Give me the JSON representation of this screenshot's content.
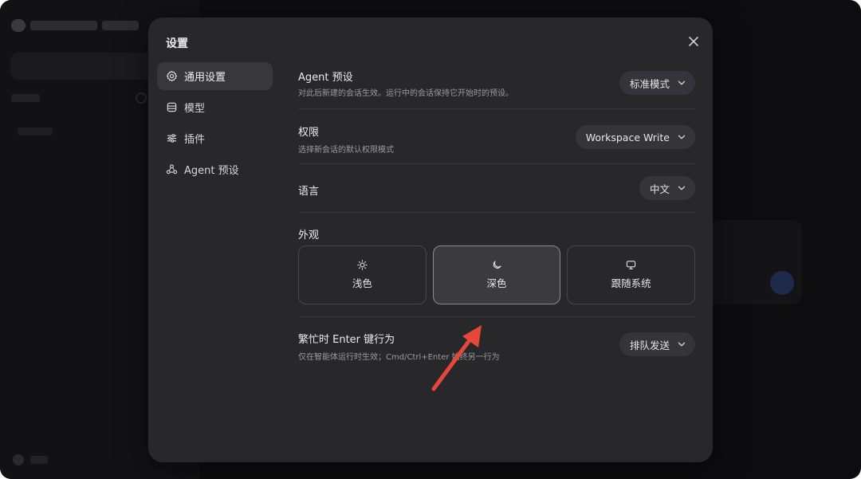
{
  "modal": {
    "title": "设置",
    "nav": [
      {
        "label": "通用设置",
        "icon": "gear-icon",
        "active": true
      },
      {
        "label": "模型",
        "icon": "database-icon"
      },
      {
        "label": "插件",
        "icon": "sliders-icon"
      },
      {
        "label": "Agent 预设",
        "icon": "agent-icon"
      }
    ]
  },
  "settings": {
    "agent_preset": {
      "title": "Agent 预设",
      "desc": "对此后新建的会话生效。运行中的会话保持它开始时的预设。",
      "value": "标准模式"
    },
    "permission": {
      "title": "权限",
      "desc": "选择新会话的默认权限模式",
      "value": "Workspace Write"
    },
    "language": {
      "title": "语言",
      "value": "中文"
    },
    "appearance": {
      "title": "外观",
      "options": [
        {
          "label": "浅色",
          "icon": "sun-icon"
        },
        {
          "label": "深色",
          "icon": "moon-icon",
          "selected": true
        },
        {
          "label": "跟随系统",
          "icon": "monitor-icon"
        }
      ]
    },
    "busy_enter": {
      "title": "繁忙时 Enter 键行为",
      "desc": "仅在智能体运行时生效；Cmd/Ctrl+Enter 始终另一行为",
      "value": "排队发送"
    }
  },
  "colors": {
    "accent_arrow": "#e5483b",
    "modal_bg": "#28282b"
  }
}
